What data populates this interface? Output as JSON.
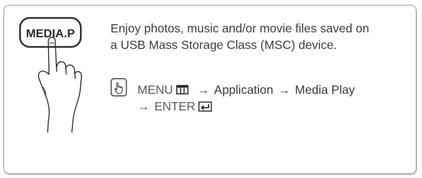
{
  "remote_button": {
    "label": "MEDIA.P"
  },
  "description": {
    "line1": "Enjoy photos, music and/or movie files saved on",
    "line2": "a USB Mass Storage Class (MSC) device."
  },
  "navigation": {
    "menu": "MENU",
    "arrow": "→",
    "item1": "Application",
    "item2": "Media Play",
    "enter": "ENTER"
  },
  "icons": {
    "remote": "hand-pressing-button-icon",
    "navigation": "remote-hand-icon",
    "menu": "menu-icon",
    "enter": "enter-icon"
  }
}
